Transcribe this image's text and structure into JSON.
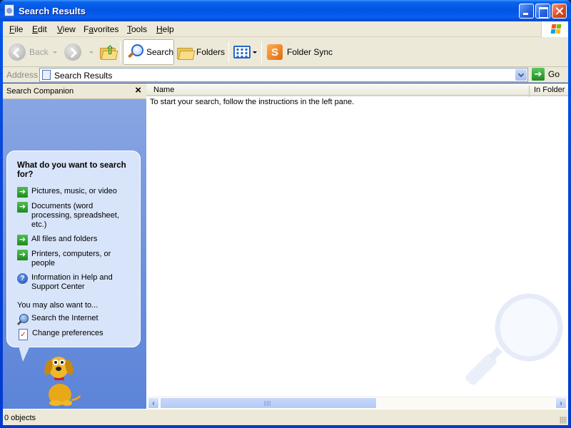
{
  "window": {
    "title": "Search Results"
  },
  "menubar": {
    "items": [
      {
        "label": "File",
        "accel": "F",
        "rest": "ile"
      },
      {
        "label": "Edit",
        "accel": "E",
        "rest": "dit"
      },
      {
        "label": "View",
        "accel": "V",
        "rest": "iew"
      },
      {
        "label": "Favorites",
        "pre": "F",
        "accel": "a",
        "rest": "vorites"
      },
      {
        "label": "Tools",
        "accel": "T",
        "rest": "ools"
      },
      {
        "label": "Help",
        "accel": "H",
        "rest": "elp"
      }
    ]
  },
  "toolbar": {
    "back_label": "Back",
    "search_label": "Search",
    "folders_label": "Folders",
    "folder_sync_label": "Folder Sync",
    "sync_icon_letter": "S"
  },
  "address": {
    "label": "Address",
    "value": "Search Results",
    "go_label": "Go"
  },
  "left_pane": {
    "title": "Search Companion",
    "close_glyph": "×",
    "prompt": "What do you want to search for?",
    "options": [
      {
        "label": "Pictures, music, or video",
        "icon": "arrow-icon"
      },
      {
        "label": "Documents (word processing, spreadsheet, etc.)",
        "icon": "arrow-icon"
      },
      {
        "label": "All files and folders",
        "icon": "arrow-icon"
      },
      {
        "label": "Printers, computers, or people",
        "icon": "arrow-icon"
      },
      {
        "label": "Information in Help and Support Center",
        "icon": "help-icon"
      }
    ],
    "also_label": "You may also want to...",
    "also_options": [
      {
        "label": "Search the Internet",
        "icon": "internet-search-icon"
      },
      {
        "label": "Change preferences",
        "icon": "preferences-icon"
      }
    ]
  },
  "results": {
    "columns": [
      "Name",
      "In Folder"
    ],
    "instructions": "To start your search, follow the instructions in the left pane."
  },
  "statusbar": {
    "text": "0 objects"
  },
  "colors": {
    "titlebar": "#0054e3",
    "chrome": "#ece9d8",
    "left_pane": "#6b8fdc",
    "bubble": "#d8e4fa",
    "go_green": "#1f8a1f"
  }
}
